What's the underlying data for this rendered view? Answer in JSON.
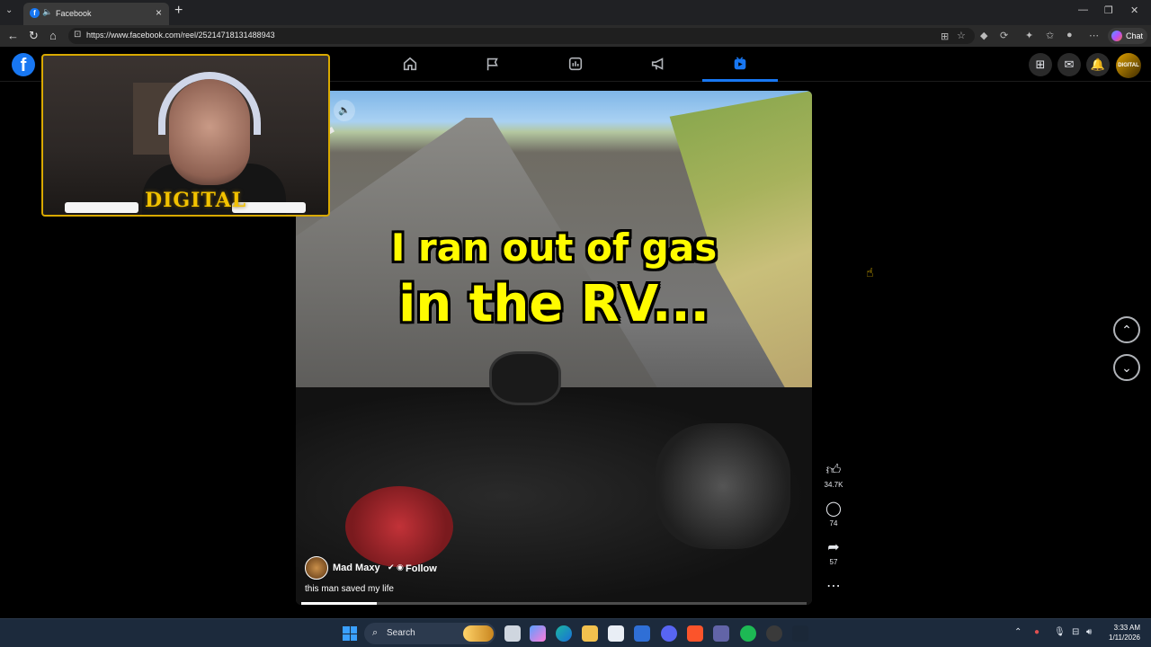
{
  "browser": {
    "tab_title": "Facebook",
    "url": "https://www.facebook.com/reel/25214718131488943",
    "chat_label": "Chat"
  },
  "facebook": {
    "logo_letter": "f",
    "avatar_text": "DIGITAL",
    "active_nav": "reels"
  },
  "webcam": {
    "overlay_text": "DIGITAL"
  },
  "reel": {
    "overlay_line1": "I ran out of gas",
    "overlay_line2": "in the RV...",
    "author_name": "Mad Maxy",
    "follow_label": "Follow",
    "caption": "this man saved my life",
    "progress_fraction": 0.15,
    "likes": "34.7K",
    "comments": "74",
    "shares": "57"
  },
  "taskbar": {
    "search_label": "Search",
    "time": "3:33 AM",
    "date": "1/11/2026"
  },
  "colors": {
    "facebook_blue": "#1877f2",
    "caption_yellow": "#fffb00",
    "webcam_border": "#d9a900"
  }
}
